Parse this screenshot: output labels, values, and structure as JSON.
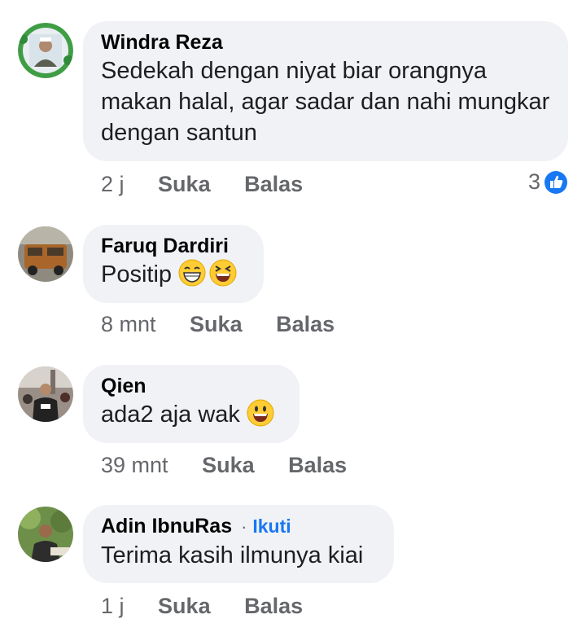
{
  "comments": [
    {
      "author": "Windra Reza",
      "text": "Sedekah dengan niyat biar orangnya makan halal, agar sadar dan nahi mungkar dengan santun",
      "time": "2 j",
      "like_label": "Suka",
      "reply_label": "Balas",
      "reaction_count": "3",
      "reaction_icon": "like-thumb-icon"
    },
    {
      "author": "Faruq Dardiri",
      "text": "Positip",
      "emojis": [
        "grinning-squinting-face-icon",
        "laughing-squinting-face-icon"
      ],
      "time": "8 mnt",
      "like_label": "Suka",
      "reply_label": "Balas"
    },
    {
      "author": "Qien",
      "text": "ada2 aja wak",
      "emojis": [
        "smiling-face-icon"
      ],
      "time": "39 mnt",
      "like_label": "Suka",
      "reply_label": "Balas"
    },
    {
      "author": "Adin IbnuRas",
      "follow_separator": "·",
      "follow_label": "Ikuti",
      "text": "Terima kasih ilmunya kiai",
      "time": "1 j",
      "like_label": "Suka",
      "reply_label": "Balas"
    }
  ],
  "colors": {
    "bubble": "#f0f2f5",
    "secondary_text": "#65676b",
    "link_blue": "#1877f2"
  }
}
